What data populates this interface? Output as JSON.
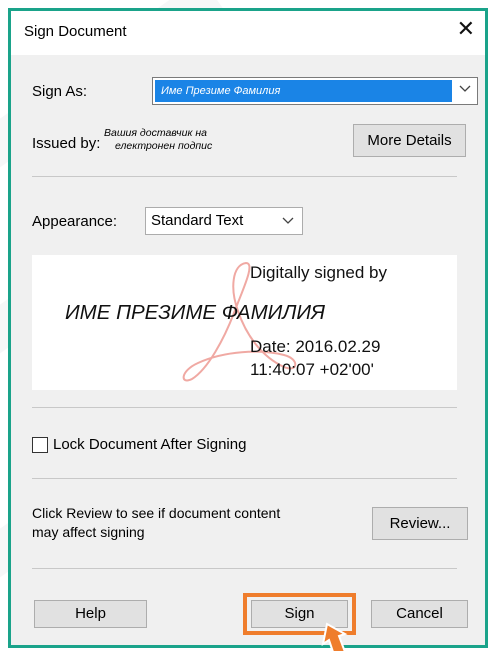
{
  "dialog": {
    "title": "Sign Document",
    "close_glyph": "✕"
  },
  "sign_as": {
    "label": "Sign As:",
    "selected": "Име Презиме Фамилия"
  },
  "issued_by": {
    "label": "Issued by:",
    "line1": "Вашия доставчик на",
    "line2": "електронен подпис"
  },
  "more_details_button": "More Details",
  "appearance": {
    "label": "Appearance:",
    "selected": "Standard Text"
  },
  "preview": {
    "name": "ИМЕ ПРЕЗИМЕ ФАМИЛИЯ",
    "line1": "Digitally signed by",
    "line2": "Date: 2016.02.29",
    "line3": "11:40:07 +02'00'"
  },
  "lock_checkbox": {
    "label": "Lock Document After Signing",
    "checked": false
  },
  "review": {
    "text_line1": "Click Review to see if document content",
    "text_line2": "may affect signing",
    "button": "Review..."
  },
  "buttons": {
    "help": "Help",
    "sign": "Sign",
    "cancel": "Cancel"
  },
  "colors": {
    "dialog_border": "#1aa38a",
    "selection_blue": "#1a84e6",
    "callout_orange": "#ef7d2c",
    "watermark_red": "#e33a2f"
  },
  "icons": {
    "close": "close-icon",
    "dropdown": "chevron-down-icon",
    "pointer": "arrow-pointer-icon"
  }
}
